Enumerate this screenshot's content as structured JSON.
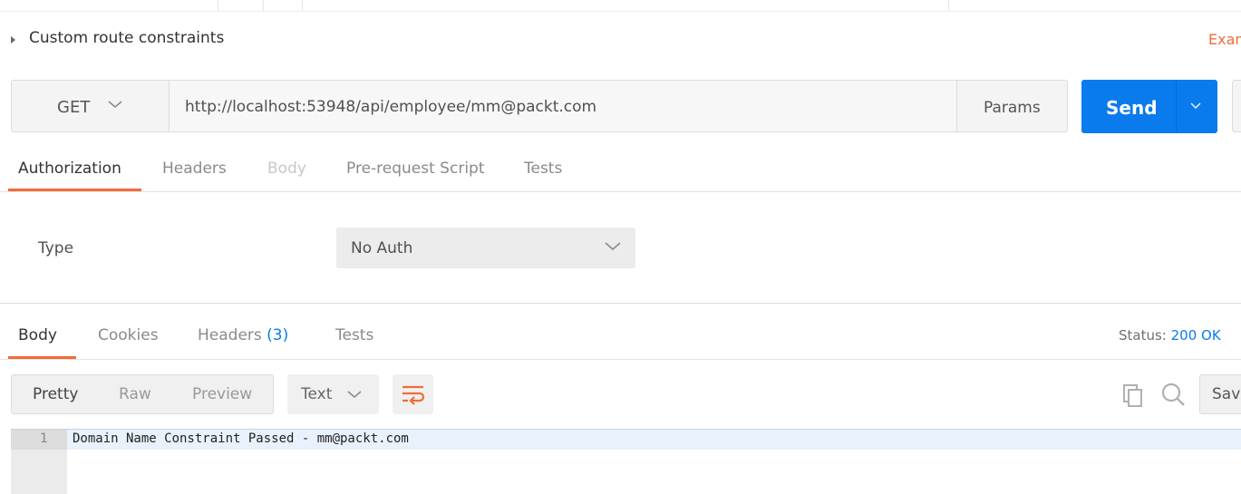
{
  "header": {
    "request_name": "Custom route constraints",
    "examples_link": "Examples"
  },
  "url_bar": {
    "method": "GET",
    "url": "http://localhost:53948/api/employee/mm@packt.com",
    "params_label": "Params",
    "send_label": "Send"
  },
  "request_tabs": [
    {
      "label": "Authorization",
      "state": "active"
    },
    {
      "label": "Headers",
      "state": "inactive"
    },
    {
      "label": "Body",
      "state": "disabled"
    },
    {
      "label": "Pre-request Script",
      "state": "inactive"
    },
    {
      "label": "Tests",
      "state": "inactive"
    }
  ],
  "auth": {
    "type_label": "Type",
    "type_value": "No Auth"
  },
  "response_tabs": {
    "body": "Body",
    "cookies": "Cookies",
    "headers": "Headers",
    "headers_count": "(3)",
    "tests": "Tests"
  },
  "status": {
    "label": "Status:",
    "value": "200 OK"
  },
  "response_toolbar": {
    "views": [
      {
        "label": "Pretty",
        "active": true
      },
      {
        "label": "Raw",
        "active": false
      },
      {
        "label": "Preview",
        "active": false
      }
    ],
    "format": "Text",
    "save_label": "Save"
  },
  "response_body": {
    "lines": [
      {
        "number": "1",
        "text": "Domain Name Constraint Passed - mm@packt.com"
      }
    ]
  },
  "colors": {
    "accent_orange": "#f26b3a",
    "send_blue": "#097bed"
  },
  "icons": {
    "collapse": "caret-right-icon",
    "method_dropdown": "chevron-down-icon",
    "send_dropdown": "chevron-down-icon",
    "auth_dropdown": "chevron-down-icon",
    "format_dropdown": "chevron-down-icon",
    "wrap": "wrap-lines-icon",
    "copy": "copy-icon",
    "search": "search-icon"
  }
}
